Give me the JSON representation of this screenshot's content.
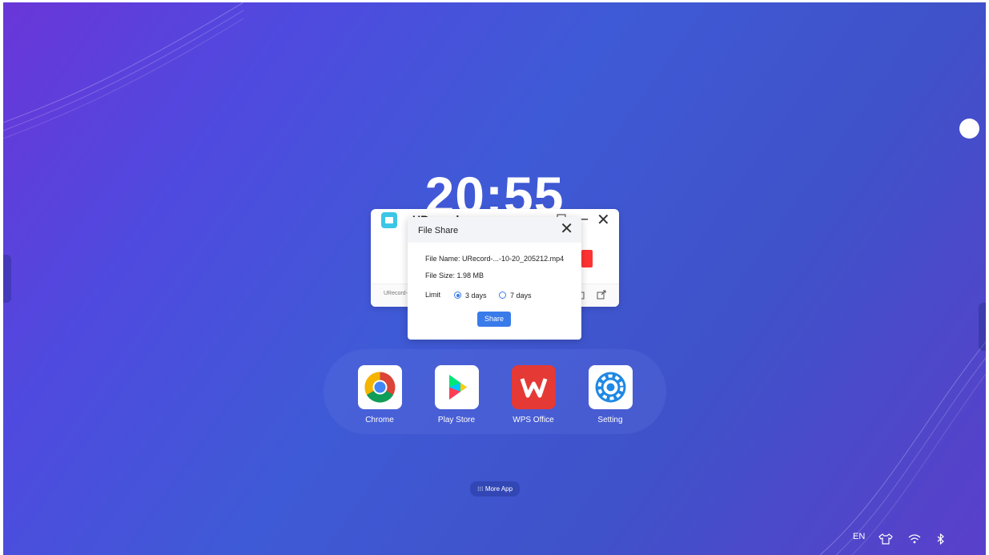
{
  "clock": {
    "time": "20:55"
  },
  "urecord": {
    "title": "URecord",
    "file_label": "URecord-2",
    "minimize": "–",
    "close": "✕"
  },
  "file_share": {
    "title": "File Share",
    "close": "✕",
    "file_name": "File Name: URecord-...-10-20_205212.mp4",
    "file_size": "File Size: 1.98 MB",
    "limit_label": "Limit",
    "options": [
      {
        "label": "3 days",
        "selected": true
      },
      {
        "label": "7 days",
        "selected": false
      }
    ],
    "share_button": "Share"
  },
  "dock": {
    "apps": [
      {
        "label": "Chrome",
        "icon": "chrome-icon"
      },
      {
        "label": "Play Store",
        "icon": "play-store-icon"
      },
      {
        "label": "WPS Office",
        "icon": "wps-office-icon"
      },
      {
        "label": "Setting",
        "icon": "settings-gear-icon"
      }
    ]
  },
  "more_app": {
    "label": "More App",
    "icon": "grid-icon"
  },
  "status_bar": {
    "language": "EN",
    "icons": [
      "shirt-icon",
      "wifi-icon",
      "bluetooth-icon"
    ]
  },
  "colors": {
    "accent": "#3a7bea",
    "wps_red": "#e53935",
    "record_red": "#ff3333",
    "urecord_logo": "#3cc6e6"
  }
}
